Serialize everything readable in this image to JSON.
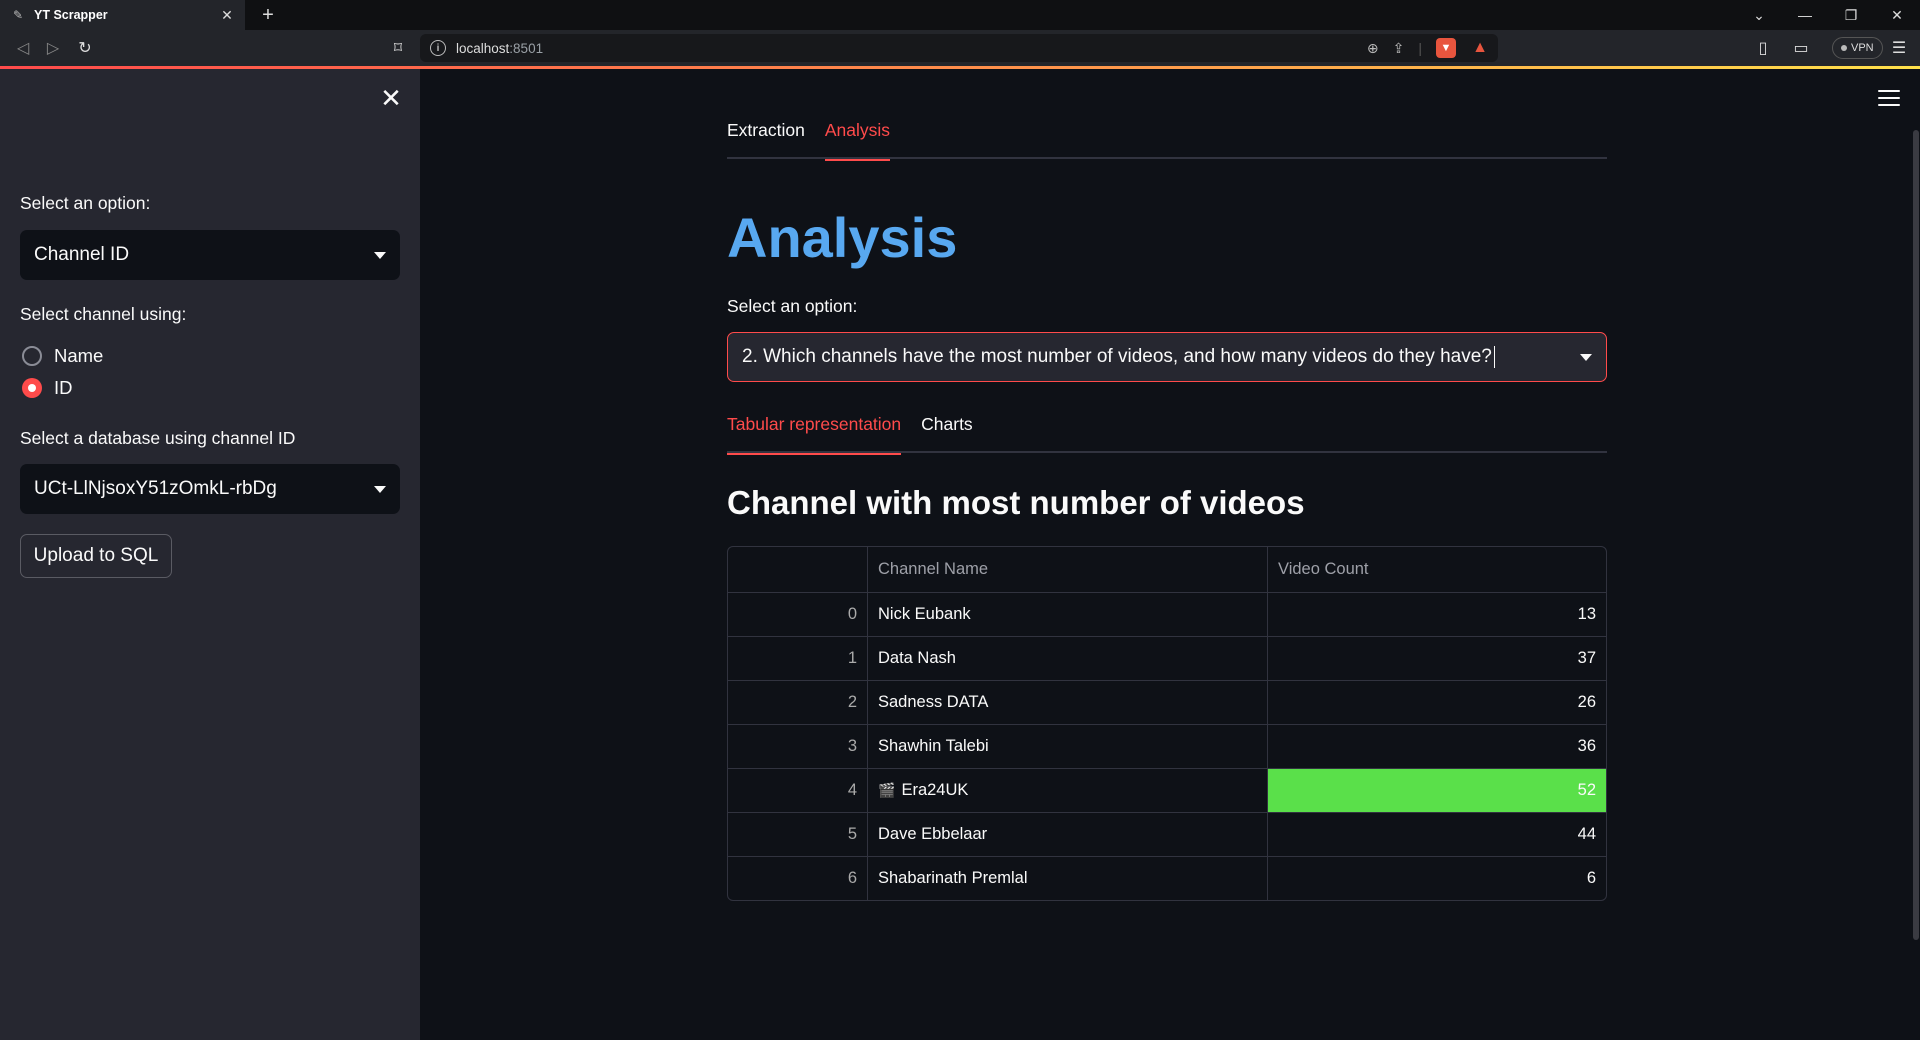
{
  "browser": {
    "tab_title": "YT Scrapper",
    "url_host": "localhost",
    "url_port": ":8501",
    "vpn_label": "VPN"
  },
  "sidebar": {
    "select_label": "Select an option:",
    "select_value": "Channel ID",
    "radio_label": "Select channel using:",
    "radio_options": [
      "Name",
      "ID"
    ],
    "radio_selected": "ID",
    "db_label": "Select a database using channel ID",
    "db_value": "UCt-LlNjsoxY51zOmkL-rbDg",
    "upload_button": "Upload to SQL"
  },
  "main": {
    "tabs": [
      "Extraction",
      "Analysis"
    ],
    "active_tab": "Analysis",
    "title": "Analysis",
    "select_label": "Select an option:",
    "question": "2. Which channels have the most number of videos, and how many videos do they have?",
    "subtabs": [
      "Tabular representation",
      "Charts"
    ],
    "active_subtab": "Tabular representation",
    "section_title": "Channel with most number of videos",
    "table": {
      "headers": [
        "",
        "Channel Name",
        "Video Count"
      ],
      "rows": [
        {
          "idx": "0",
          "name": "Nick Eubank",
          "count": "13"
        },
        {
          "idx": "1",
          "name": "Data Nash",
          "count": "37"
        },
        {
          "idx": "2",
          "name": "Sadness DATA",
          "count": "26"
        },
        {
          "idx": "3",
          "name": "Shawhin Talebi",
          "count": "36"
        },
        {
          "idx": "4",
          "name": "Era24UK",
          "count": "52"
        },
        {
          "idx": "5",
          "name": "Dave Ebbelaar",
          "count": "44"
        },
        {
          "idx": "6",
          "name": "Shabarinath Premlal",
          "count": "6"
        }
      ],
      "highlight_row": 4,
      "highlight_color": "#5ae04a"
    }
  },
  "colors": {
    "accent": "#ff4b4b",
    "title": "#58a8f0",
    "sidebar_bg": "#262730",
    "main_bg": "#0e1117"
  }
}
